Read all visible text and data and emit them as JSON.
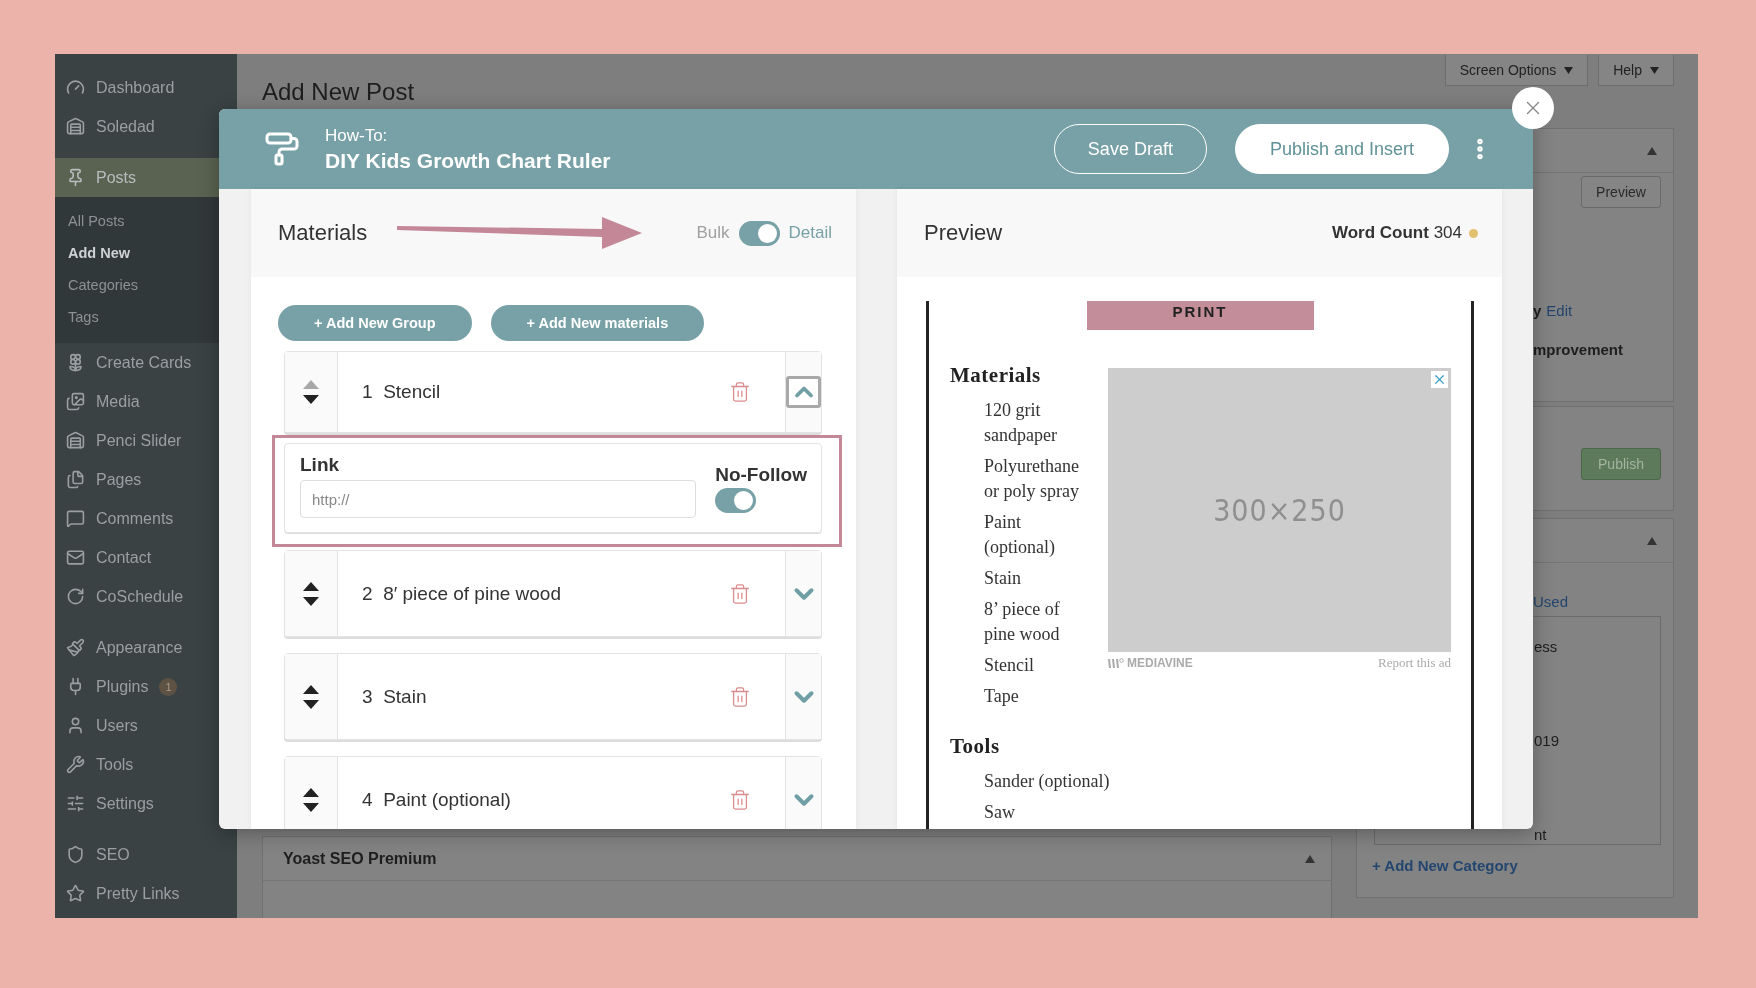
{
  "sidebar": {
    "groups": [
      [
        {
          "label": "Dashboard",
          "selected": false
        },
        {
          "label": "Soledad",
          "selected": false
        }
      ],
      [
        {
          "label": "Posts",
          "selected": true,
          "children": [
            {
              "label": "All Posts",
              "selected": false
            },
            {
              "label": "Add New",
              "selected": true
            },
            {
              "label": "Categories",
              "selected": false
            },
            {
              "label": "Tags",
              "selected": false
            }
          ]
        },
        {
          "label": "Create Cards",
          "selected": false
        },
        {
          "label": "Media",
          "selected": false
        },
        {
          "label": "Penci Slider",
          "selected": false
        },
        {
          "label": "Pages",
          "selected": false
        },
        {
          "label": "Comments",
          "selected": false
        },
        {
          "label": "Contact",
          "selected": false
        },
        {
          "label": "CoSchedule",
          "selected": false
        }
      ],
      [
        {
          "label": "Appearance",
          "selected": false
        },
        {
          "label": "Plugins",
          "selected": false,
          "badge": "1"
        },
        {
          "label": "Users",
          "selected": false
        },
        {
          "label": "Tools",
          "selected": false
        },
        {
          "label": "Settings",
          "selected": false
        }
      ],
      [
        {
          "label": "SEO",
          "selected": false
        },
        {
          "label": "Pretty Links",
          "selected": false
        }
      ]
    ]
  },
  "page": {
    "title": "Add New Post",
    "screen_options": "Screen Options",
    "help": "Help"
  },
  "side_boxes": [
    {
      "kind": "publish",
      "collapsible": true,
      "button": "Preview",
      "rows": [
        {
          "text": "y",
          "link": "Edit"
        },
        {
          "text": "mprovement"
        }
      ]
    },
    {
      "kind": "actions",
      "collapsible": false,
      "button": "Publish"
    },
    {
      "kind": "categories",
      "collapsible": true,
      "tab": "Used",
      "list": [
        "ess",
        "019",
        "nt"
      ],
      "add_link": "+ Add New Category"
    }
  ],
  "yoast": {
    "title": "Yoast SEO Premium"
  },
  "modal": {
    "eyebrow": "How-To:",
    "title": "DIY Kids Growth Chart Ruler",
    "buttons": [
      {
        "label": "Save Draft",
        "kind": "outline"
      },
      {
        "label": "Publish and Insert",
        "kind": "filled"
      }
    ]
  },
  "materials": {
    "title": "Materials",
    "mode": {
      "off_label": "Bulk",
      "on_label": "Detail",
      "on": true
    },
    "actions": [
      "+ Add New Group",
      "+ Add New materials"
    ],
    "items": [
      {
        "number": "1",
        "name": "Stencil",
        "expanded": true,
        "up_disabled": true,
        "link": {
          "label": "Link",
          "placeholder": "http://"
        },
        "nofollow": {
          "label": "No-Follow",
          "on": true
        }
      },
      {
        "number": "2",
        "name": "8′ piece of pine wood",
        "expanded": false,
        "up_disabled": false
      },
      {
        "number": "3",
        "name": "Stain",
        "expanded": false,
        "up_disabled": false
      },
      {
        "number": "4",
        "name": "Paint (optional)",
        "expanded": false,
        "up_disabled": false
      }
    ]
  },
  "preview": {
    "title": "Preview",
    "word_count_label": "Word Count",
    "word_count": "304",
    "print_button": "PRINT",
    "sections": [
      {
        "heading": "Materials",
        "items": [
          "120 grit sandpaper",
          "Polyurethane or poly spray",
          "Paint (optional)",
          "Stain",
          "8’ piece of pine wood",
          "Stencil",
          "Tape"
        ]
      },
      {
        "heading": "Tools",
        "items": [
          "Sander (optional)",
          "Saw"
        ]
      }
    ],
    "ad": {
      "size": "300×250",
      "brand": "MEDIAVINE",
      "report": "Report this ad"
    }
  }
}
